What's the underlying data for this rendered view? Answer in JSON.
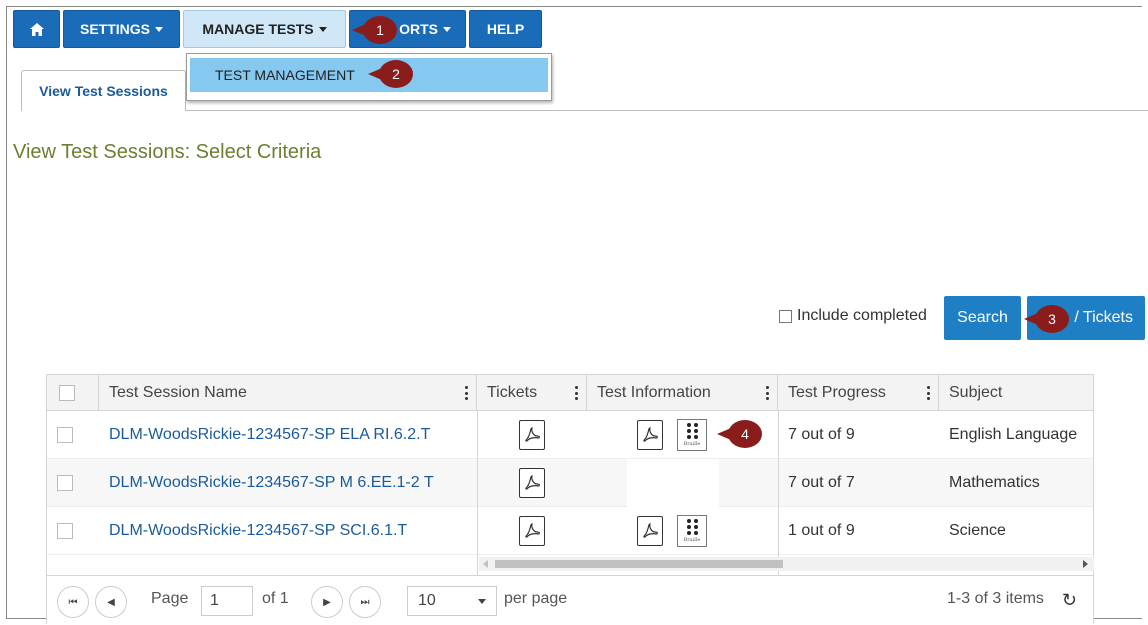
{
  "nav": {
    "items": [
      {
        "label": ""
      },
      {
        "label": "SETTINGS"
      },
      {
        "label": "MANAGE TESTS"
      },
      {
        "label": "ORTS"
      },
      {
        "label": "HELP"
      }
    ],
    "dropdown_item": "TEST MANAGEMENT"
  },
  "tabs": {
    "active": "View Test Sessions"
  },
  "page_title": "View Test Sessions: Select Criteria",
  "filters": {
    "include_completed": "Include completed",
    "search_label": "Search",
    "tickets_label": "/ Tickets"
  },
  "callouts": [
    "1",
    "2",
    "3",
    "4"
  ],
  "grid": {
    "columns": [
      "Test Session Name",
      "Tickets",
      "Test Information",
      "Test Progress",
      "Subject"
    ],
    "rows": [
      {
        "name": "DLM-WoodsRickie-1234567-SP ELA RI.6.2.T",
        "progress": "7 out of 9",
        "subject": "English Language",
        "has_test_info": true
      },
      {
        "name": "DLM-WoodsRickie-1234567-SP M 6.EE.1-2 T",
        "progress": "7 out of 7",
        "subject": "Mathematics",
        "has_test_info": false
      },
      {
        "name": "DLM-WoodsRickie-1234567-SP SCI.6.1.T",
        "progress": "1 out of 9",
        "subject": "Science",
        "has_test_info": true
      }
    ],
    "braille_label": "Braille"
  },
  "pager": {
    "page_label": "Page",
    "page_value": "1",
    "of_label": "of 1",
    "per_page_value": "10",
    "per_page_label": "per page",
    "items_info": "1-3 of 3 items"
  },
  "colors": {
    "nav_blue": "#1a6bb8",
    "callout": "#8a1c1c",
    "title_green": "#6b7f32",
    "link": "#1b5a9a"
  }
}
